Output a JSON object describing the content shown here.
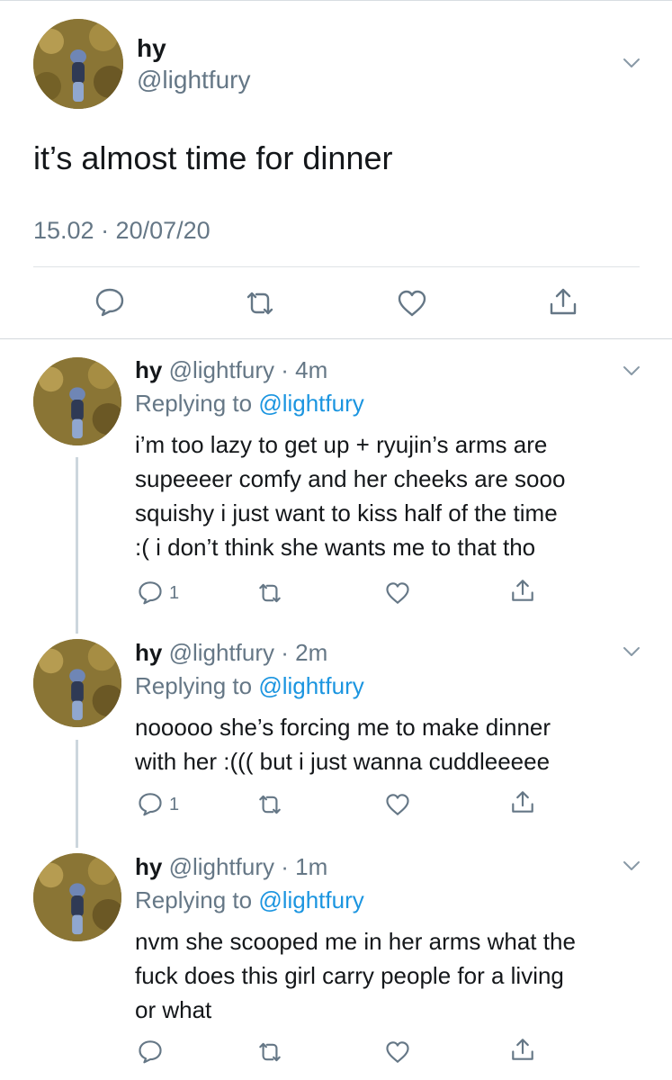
{
  "main_tweet": {
    "name": "hy",
    "handle": "@lightfury",
    "text": "it’s almost time for dinner",
    "timestamp": "15.02 · 20/07/20",
    "actions": [
      "reply-icon",
      "retweet-icon",
      "like-icon",
      "share-icon"
    ]
  },
  "replies": [
    {
      "name": "hy",
      "handle_time": "@lightfury · 4m",
      "replying_prefix": "Replying to ",
      "replying_to": "@lightfury",
      "lines": [
        "i’m too lazy to get up + ryujin’s arms are",
        "supeeeer comfy and her cheeks are sooo",
        "squishy i just want to kiss half of the time",
        ":( i don’t think she wants me to that tho"
      ],
      "reply_count": "1"
    },
    {
      "name": "hy",
      "handle_time": "@lightfury · 2m",
      "replying_prefix": "Replying to ",
      "replying_to": "@lightfury",
      "lines": [
        "nooooo she’s forcing me to make dinner",
        "with her :((( but i just wanna cuddleeeee"
      ],
      "reply_count": "1"
    },
    {
      "name": "hy",
      "handle_time": "@lightfury · 1m",
      "replying_prefix": "Replying to ",
      "replying_to": "@lightfury",
      "lines": [
        "nvm she scooped me in her arms what the",
        "fuck does this girl carry people for a living",
        "or what"
      ],
      "reply_count": ""
    }
  ],
  "colors": {
    "text": "#14171a",
    "secondary": "#657786",
    "link": "#1b95e0",
    "divider": "#dfe3e6"
  }
}
